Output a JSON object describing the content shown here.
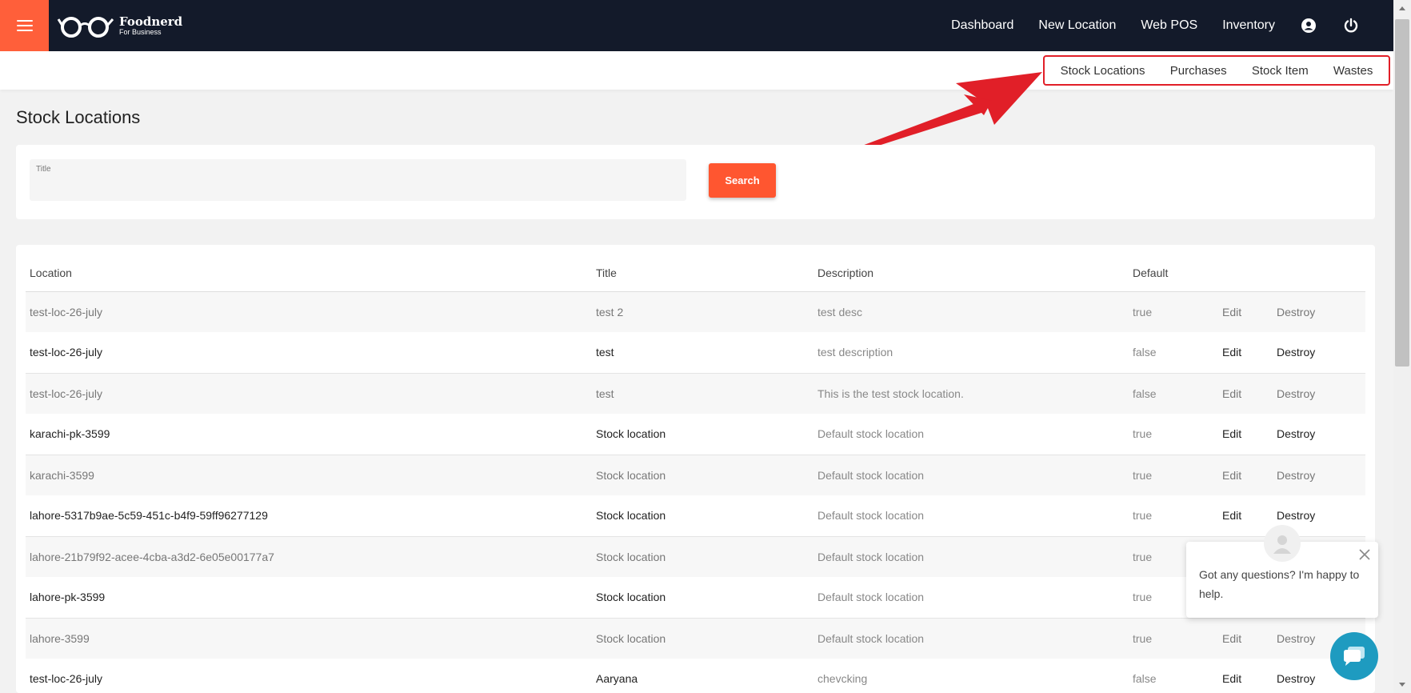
{
  "header": {
    "brand": "Foodnerd",
    "brand_sub": "For Business",
    "nav": [
      "Dashboard",
      "New Location",
      "Web POS",
      "Inventory"
    ]
  },
  "subnav": [
    "Stock Locations",
    "Purchases",
    "Stock Item",
    "Wastes"
  ],
  "page": {
    "title": "Stock Locations"
  },
  "search": {
    "title_label": "Title",
    "title_value": "",
    "button_label": "Search"
  },
  "table": {
    "columns": [
      "Location",
      "Title",
      "Description",
      "Default",
      "",
      ""
    ],
    "rows": [
      {
        "location": "test-loc-26-july",
        "title": "test 2",
        "description": "test desc",
        "default": "true",
        "edit": "Edit",
        "destroy": "Destroy"
      },
      {
        "location": "test-loc-26-july",
        "title": "test",
        "description": "test description",
        "default": "false",
        "edit": "Edit",
        "destroy": "Destroy"
      },
      {
        "location": "test-loc-26-july",
        "title": "test",
        "description": "This is the test stock location.",
        "default": "false",
        "edit": "Edit",
        "destroy": "Destroy"
      },
      {
        "location": "karachi-pk-3599",
        "title": "Stock location",
        "description": "Default stock location",
        "default": "true",
        "edit": "Edit",
        "destroy": "Destroy"
      },
      {
        "location": "karachi-3599",
        "title": "Stock location",
        "description": "Default stock location",
        "default": "true",
        "edit": "Edit",
        "destroy": "Destroy"
      },
      {
        "location": "lahore-5317b9ae-5c59-451c-b4f9-59ff96277129",
        "title": "Stock location",
        "description": "Default stock location",
        "default": "true",
        "edit": "Edit",
        "destroy": "Destroy"
      },
      {
        "location": "lahore-21b79f92-acee-4cba-a3d2-6e05e00177a7",
        "title": "Stock location",
        "description": "Default stock location",
        "default": "true",
        "edit": "",
        "destroy": ""
      },
      {
        "location": "lahore-pk-3599",
        "title": "Stock location",
        "description": "Default stock location",
        "default": "true",
        "edit": "",
        "destroy": ""
      },
      {
        "location": "lahore-3599",
        "title": "Stock location",
        "description": "Default stock location",
        "default": "true",
        "edit": "Edit",
        "destroy": "Destroy"
      },
      {
        "location": "test-loc-26-july",
        "title": "Aaryana",
        "description": "chevcking",
        "default": "false",
        "edit": "Edit",
        "destroy": "Destroy"
      }
    ]
  },
  "chat": {
    "message": "Got any questions? I'm happy to help."
  },
  "colors": {
    "navbar": "#131a2a",
    "accent": "#ff5f3a",
    "highlight_border": "#e11f28",
    "chat_button": "#1e9bc0"
  },
  "icons": [
    "hamburger-icon",
    "glasses-logo-icon",
    "account-circle-icon",
    "power-icon",
    "red-arrow-annotation",
    "close-icon",
    "chat-icon",
    "user-avatar-icon"
  ]
}
